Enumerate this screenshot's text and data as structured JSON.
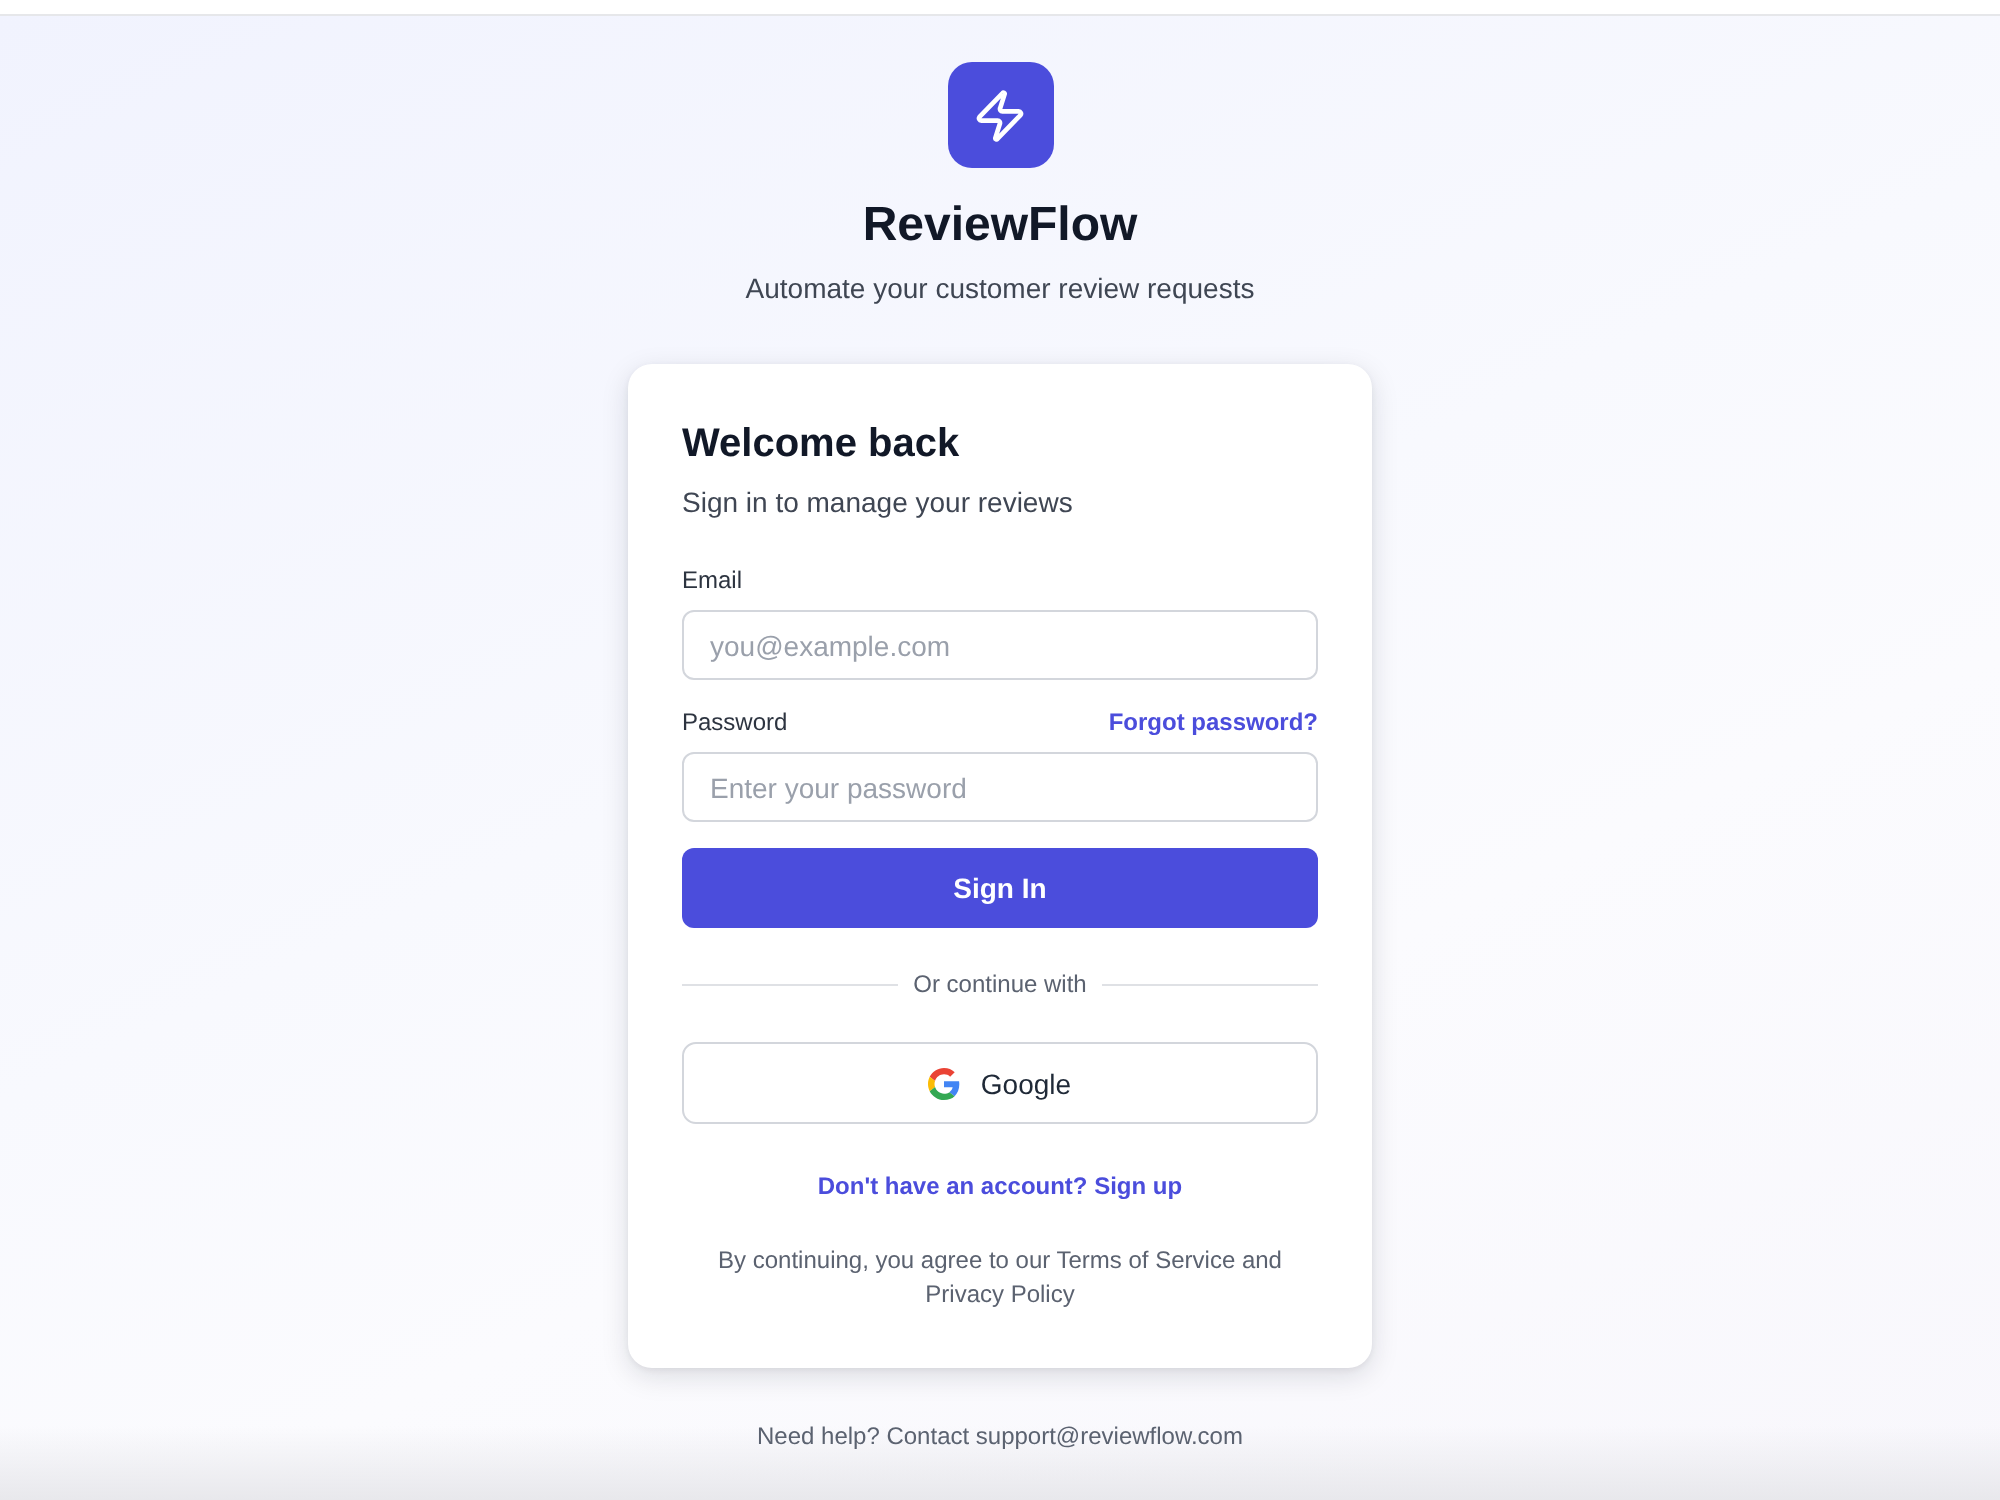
{
  "app": {
    "name": "ReviewFlow",
    "tagline": "Automate your customer review requests"
  },
  "card": {
    "title": "Welcome back",
    "subtitle": "Sign in to manage your reviews",
    "fields": [
      {
        "label": "Email",
        "placeholder": "you@example.com"
      },
      {
        "label": "Password",
        "placeholder": "Enter your password",
        "link": "Forgot password?"
      }
    ],
    "submit": "Sign In",
    "divider": "Or continue with",
    "social_button": "Google",
    "signup_link": "Don't have an account? Sign up",
    "terms": "By continuing, you agree to our Terms of Service and Privacy Policy"
  },
  "footer": "Need help? Contact support@reviewflow.com"
}
